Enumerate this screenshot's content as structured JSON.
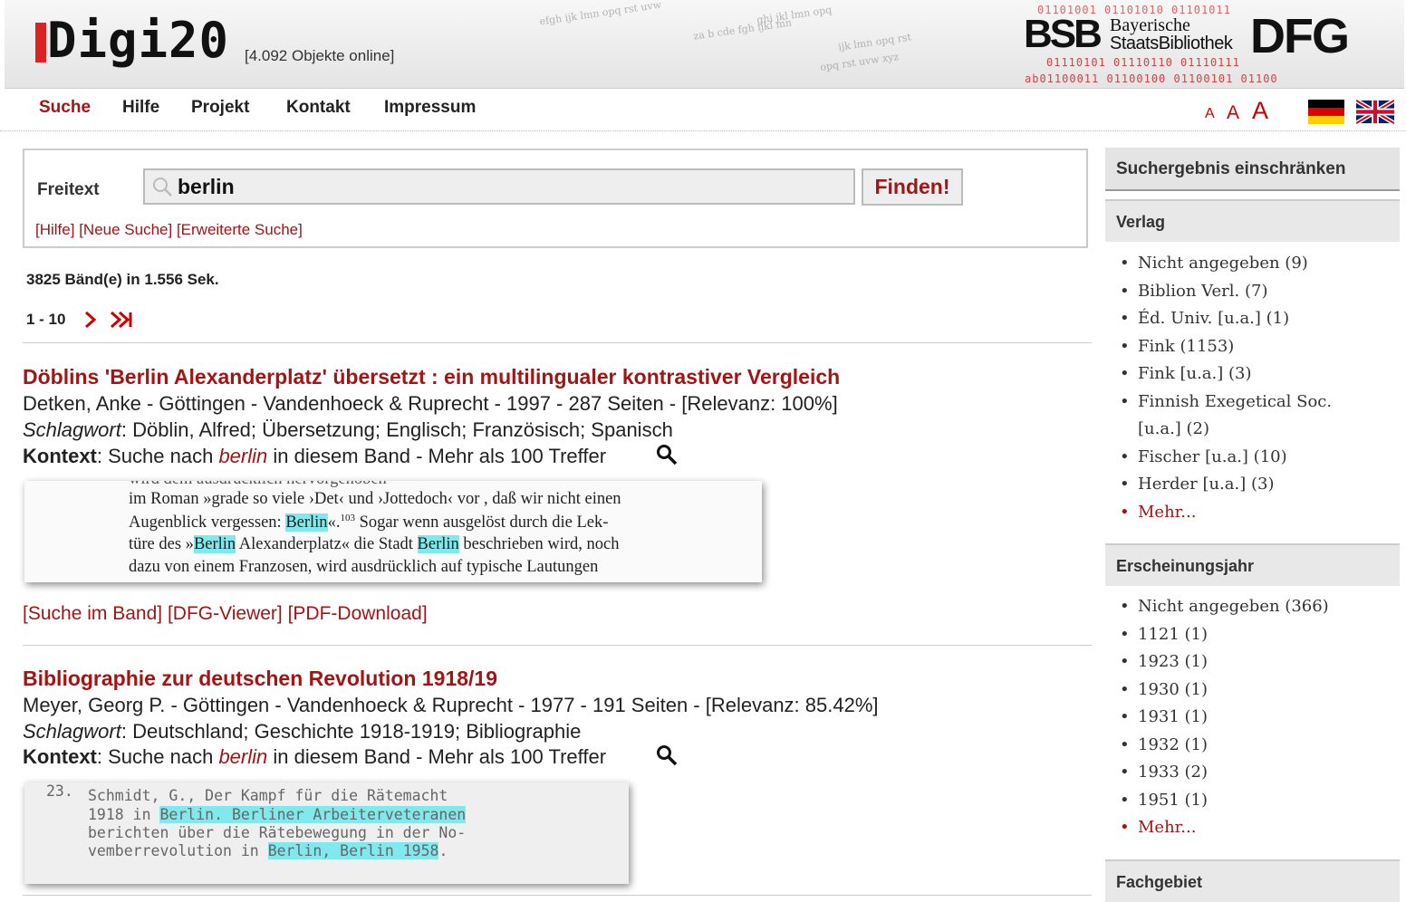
{
  "header": {
    "logo_text": "Digi20",
    "objects_online": "[4.092 Objekte online]",
    "bsb_mark": "BSB",
    "bsb_line1": "Bayerische",
    "bsb_line2": "StaatsBibliothek",
    "dfg_logo": "DFG",
    "binary_top": "01101001 01101010 01101011",
    "binary_mid": "01110101 01110110 01110111",
    "binary_bottom": "ab01100011 01100100 01100101 01100"
  },
  "nav": {
    "items": [
      "Suche",
      "Hilfe",
      "Projekt",
      "Kontakt",
      "Impressum"
    ],
    "font_small": "A",
    "font_medium": "A",
    "font_large": "A"
  },
  "search": {
    "label": "Freitext",
    "value": "berlin",
    "button": "Finden!",
    "link_help": "[Hilfe]",
    "link_new": "[Neue Suche]",
    "link_advanced": "[Erweiterte Suche]"
  },
  "results_summary": {
    "count_text": "3825 Bänd(e) in 1.556 Sek.",
    "pager_range": "1 - 10"
  },
  "results": [
    {
      "title": "Döblins 'Berlin Alexanderplatz' übersetzt : ein multilingualer kontrastiver Vergleich",
      "meta": "Detken, Anke - Göttingen - Vandenhoeck & Ruprecht - 1997 - 287 Seiten - [Relevanz: 100%]",
      "schlagwort_label": "Schlagwort",
      "schlagwort": ": Döblin, Alfred; Übersetzung; Englisch; Französisch; Spanisch",
      "kontext_label": "Kontext",
      "kontext_pre": ": Suche nach ",
      "kontext_term": "berlin",
      "kontext_post": " in diesem Band - Mehr als 100 Treffer",
      "snippet": {
        "line0": "wird dem ausdrücklich hervorgehoben",
        "line1": "im Roman »grade so viele ›Det‹ und ›Jottedoch‹ vor , daß wir nicht einen",
        "line2_a": "Augenblick vergessen: ",
        "line2_hl": "Berlin",
        "line2_b": "«.",
        "line2_sup": "103",
        "line2_c": " Sogar wenn ausgelöst durch die Lek-",
        "line3_a": "türe des »",
        "line3_hl1": "Berlin",
        "line3_b": " Alexanderplatz« die Stadt ",
        "line3_hl2": "Berlin",
        "line3_c": " beschrieben wird, noch",
        "line4": "dazu von einem Franzosen, wird ausdrücklich auf typische Lautungen"
      },
      "link_search": "[Suche im Band]",
      "link_viewer": "[DFG-Viewer]",
      "link_pdf": "[PDF-Download]"
    },
    {
      "title": "Bibliographie zur deutschen Revolution 1918/19",
      "meta": "Meyer, Georg P. - Göttingen - Vandenhoeck & Ruprecht - 1977 - 191 Seiten - [Relevanz: 85.42%]",
      "schlagwort_label": "Schlagwort",
      "schlagwort": ": Deutschland; Geschichte 1918-1919; Bibliographie",
      "kontext_label": "Kontext",
      "kontext_pre": ": Suche nach ",
      "kontext_term": "berlin",
      "kontext_post": " in diesem Band - Mehr als 100 Treffer",
      "snippet": {
        "num": "23.",
        "line1": "Schmidt, G., Der Kampf für die Rätemacht",
        "line2_a": "1918 in ",
        "line2_hl": "Berlin. Berliner Arbeiterveteranen",
        "line3": "berichten über die Rätebewegung in der No-",
        "line4_a": "vemberrevolution in ",
        "line4_hl": "Berlin, Berlin 1958",
        "line4_b": "."
      }
    }
  ],
  "sidebar": {
    "title": "Suchergebnis einschränken",
    "verlag": {
      "heading": "Verlag",
      "items": [
        "Nicht angegeben (9)",
        "Biblion Verl. (7)",
        "Éd. Univ. [u.a.] (1)",
        "Fink (1153)",
        "Fink [u.a.] (3)",
        "Finnish Exegetical Soc.",
        "[u.a.] (2)",
        "Fischer [u.a.] (10)",
        "Herder [u.a.] (3)"
      ],
      "more": "Mehr..."
    },
    "jahr": {
      "heading": "Erscheinungsjahr",
      "items": [
        "Nicht angegeben (366)",
        "1121 (1)",
        "1923 (1)",
        "1930 (1)",
        "1931 (1)",
        "1932 (1)",
        "1933 (2)",
        "1951 (1)"
      ],
      "more": "Mehr..."
    },
    "fach": {
      "heading": "Fachgebiet"
    }
  }
}
